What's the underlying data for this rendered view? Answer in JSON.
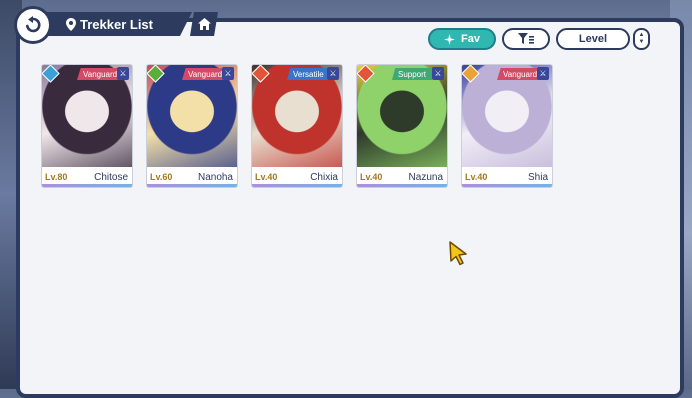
{
  "header": {
    "title": "Trekker List"
  },
  "controls": {
    "fav_label": "Fav",
    "sort_label": "Level"
  },
  "colors": {
    "accent": "#2fb8b0",
    "navy": "#2d3b5e",
    "role_tag": "#d24a66",
    "versatile_tag": "#3b73c9",
    "support_tag": "#3fa874"
  },
  "trekkers": [
    {
      "name": "Chitose",
      "level": "Lv.80",
      "role": "Vanguard",
      "element": "water",
      "element_color": "#3aa0d8",
      "role_color": "#d24a66",
      "art_colors": [
        "#3a2a3e",
        "#8a7a96",
        "#efe7ea"
      ]
    },
    {
      "name": "Nanoha",
      "level": "Lv.60",
      "role": "Vanguard",
      "element": "wind",
      "element_color": "#5cae3b",
      "role_color": "#d24a66",
      "art_colors": [
        "#2d3a88",
        "#c44a62",
        "#f3e0a8"
      ]
    },
    {
      "name": "Chixia",
      "level": "Lv.40",
      "role": "Versatile",
      "element": "fire",
      "element_color": "#e1553a",
      "role_color": "#3b73c9",
      "art_colors": [
        "#c0322c",
        "#3d2f2a",
        "#e8dfd0"
      ]
    },
    {
      "name": "Nazuna",
      "level": "Lv.40",
      "role": "Support",
      "element": "fire",
      "element_color": "#e1553a",
      "role_color": "#3fa874",
      "art_colors": [
        "#8fd26a",
        "#e6d044",
        "#2e3a2a"
      ]
    },
    {
      "name": "Shia",
      "level": "Lv.40",
      "role": "Vanguard",
      "element": "light",
      "element_color": "#e8a33b",
      "role_color": "#d24a66",
      "art_colors": [
        "#bdb0d6",
        "#3a3fa0",
        "#f2eef6"
      ]
    }
  ]
}
